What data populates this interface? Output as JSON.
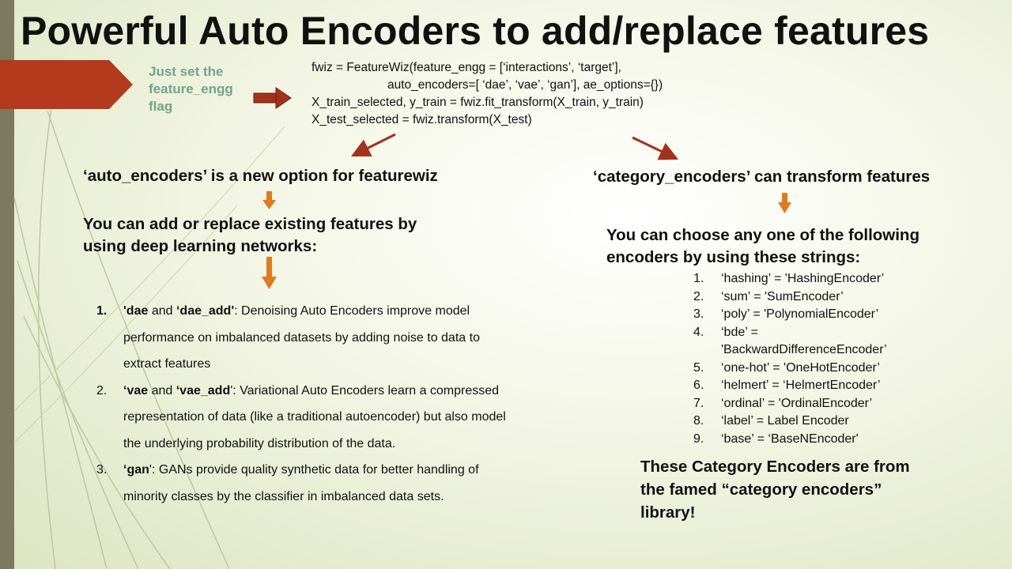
{
  "title": "Powerful Auto Encoders to add/replace features",
  "note_lines": [
    "Just set the",
    "feature_engg",
    "flag"
  ],
  "code_lines": [
    "fwiz = FeatureWiz(feature_engg =  [‘interactions’, ‘target’],",
    "auto_encoders=[ ‘dae’, ‘vae’, ‘gan’], ae_options={})",
    "X_train_selected, y_train = fwiz.fit_transform(X_train, y_train)",
    "X_test_selected = fwiz.transform(X_test)"
  ],
  "left": {
    "heading": "‘auto_encoders’ is a new option for featurewiz",
    "subheading_lines": [
      "You can add or replace existing features by",
      "using deep learning networks:"
    ],
    "items": [
      {
        "num": "1.",
        "k1": "'dae",
        "m1": " and ",
        "k2": "‘dae_add'",
        "rest": ": Denoising Auto Encoders improve model",
        "line2": "performance on imbalanced datasets by adding noise to data  to",
        "line3": "extract features"
      },
      {
        "num": "2.",
        "k1": "‘vae",
        "m1": " and ",
        "k2": "‘vae_add",
        "rest": "': Variational Auto Encoders learn a compressed",
        "line2": "representation of data (like a traditional autoencoder) but also model",
        "line3": "the underlying probability distribution of the data."
      },
      {
        "num": "3.",
        "k1": "‘gan",
        "m1": "",
        "k2": "",
        "rest": "': GANs provide quality synthetic data for better handling of",
        "line2": "minority classes by the  classifier in imbalanced data sets.",
        "line3": ""
      }
    ]
  },
  "right": {
    "heading": "‘category_encoders’ can transform features",
    "subheading_lines": [
      "You can choose any one of the following",
      "encoders by using these strings:"
    ],
    "items": [
      {
        "num": "1.",
        "text": "‘hashing’ = 'HashingEncoder’",
        "line2": ""
      },
      {
        "num": "2.",
        "text": "‘sum’ = 'SumEncoder’",
        "line2": ""
      },
      {
        "num": "3.",
        "text": "‘poly’ = 'PolynomialEncoder’",
        "line2": ""
      },
      {
        "num": "4.",
        "text": "‘bde’ =",
        "line2": "'BackwardDifferenceEncoder’"
      },
      {
        "num": "5.",
        "text": "‘one-hot’ = 'OneHotEncoder’",
        "line2": ""
      },
      {
        "num": "6.",
        "text": "‘helmert’ = ‘HelmertEncoder’",
        "line2": ""
      },
      {
        "num": "7.",
        "text": "‘ordinal’ = 'OrdinalEncoder’",
        "line2": ""
      },
      {
        "num": "8.",
        "text": "‘label’ = Label Encoder",
        "line2": ""
      },
      {
        "num": "9.",
        "text": "‘base’ = ‘BaseNEncoder'",
        "line2": ""
      }
    ],
    "footer_lines": [
      "These Category Encoders are from",
      "the famed “category encoders”",
      "library!"
    ]
  },
  "colors": {
    "accent_orange": "#e07b1f",
    "dark_red": "#a3321c",
    "tab_red": "#b33a1c",
    "note_green": "#6fa58c",
    "left_bar": "#7b7a5e"
  }
}
